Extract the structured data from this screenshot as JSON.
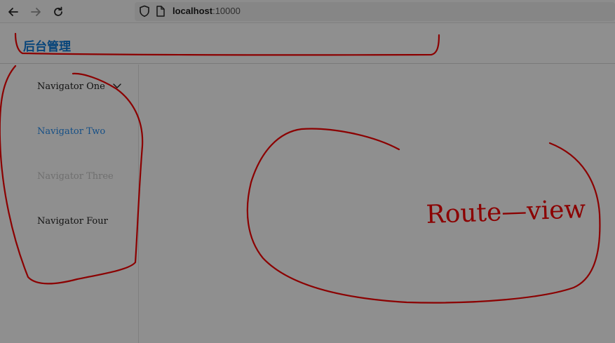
{
  "browser": {
    "url_host": "localhost",
    "url_port": ":10000",
    "back_icon": "arrow-left-icon",
    "forward_icon": "arrow-right-icon",
    "reload_icon": "reload-icon"
  },
  "header": {
    "title": "后台管理"
  },
  "sidebar": {
    "items": [
      {
        "label": "Navigator One",
        "state": "expandable"
      },
      {
        "label": "Navigator Two",
        "state": "active"
      },
      {
        "label": "Navigator Three",
        "state": "disabled"
      },
      {
        "label": "Navigator Four",
        "state": "normal"
      }
    ]
  },
  "annotation": {
    "handwritten_text": "Route—view",
    "color": "#8b0000"
  }
}
